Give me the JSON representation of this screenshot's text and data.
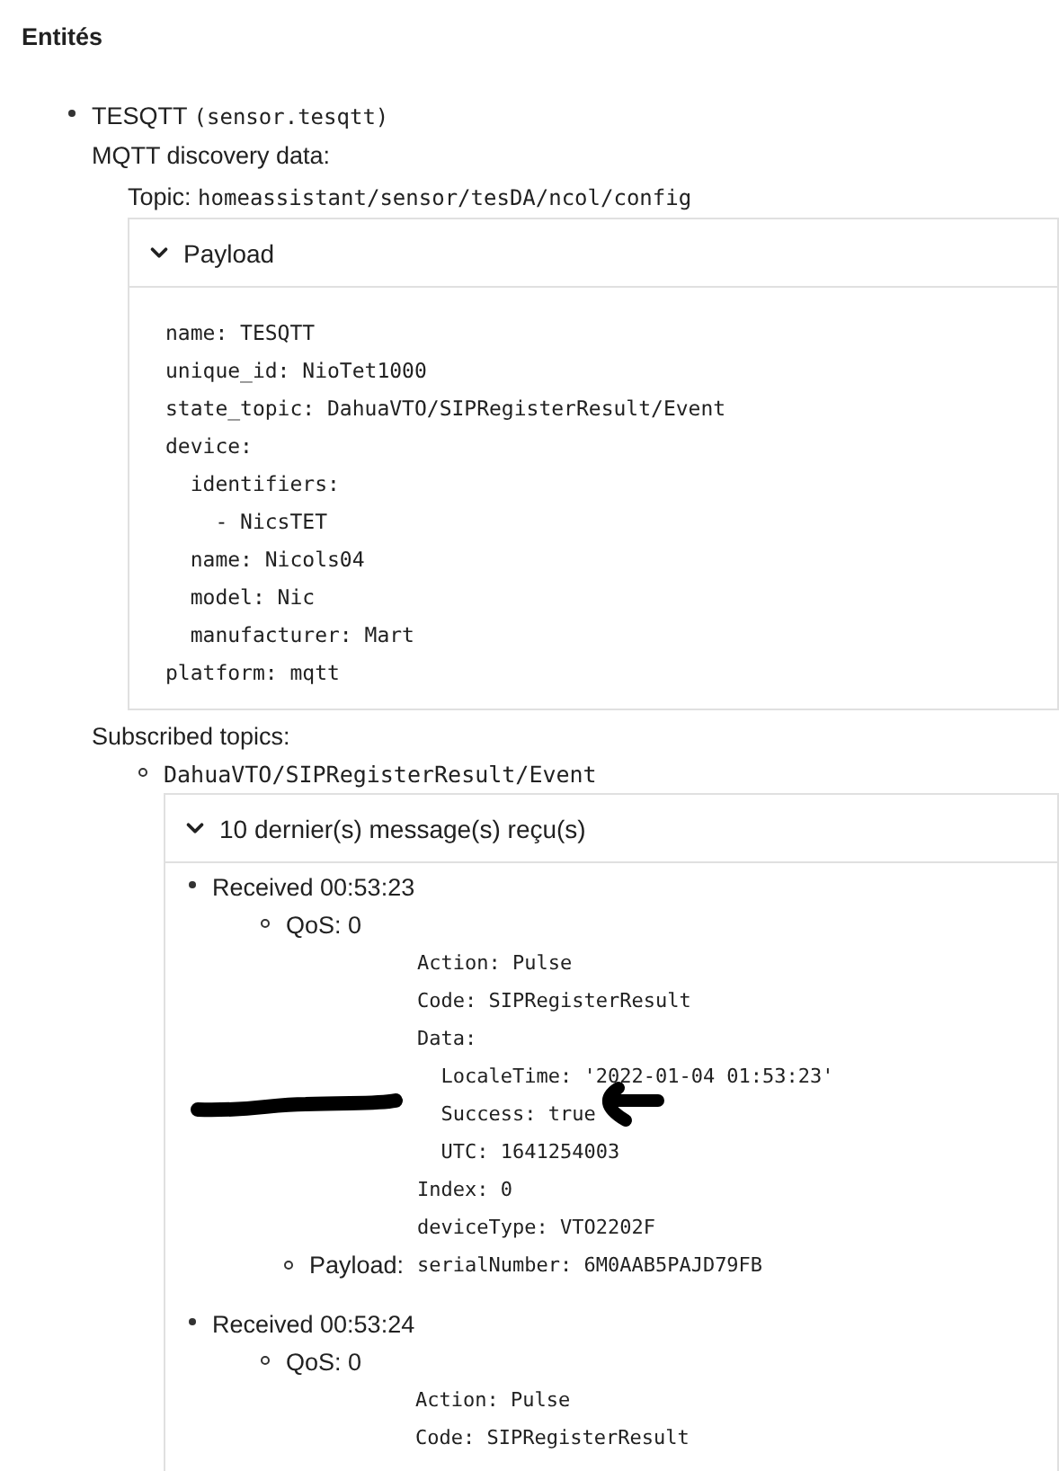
{
  "section_title": "Entités",
  "entities": [
    {
      "name": "TESQTT",
      "entity_id": "(sensor.tesqtt)",
      "discovery_label": "MQTT discovery data:",
      "topic_label": "Topic:",
      "topic": "homeassistant/sensor/tesDA/ncol/config",
      "payload_panel": {
        "title": "Payload",
        "expanded": true,
        "lines": [
          "name: TESQTT",
          "unique_id: NioTet1000",
          "state_topic: DahuaVTO/SIPRegisterResult/Event",
          "device:",
          "  identifiers:",
          "    - NicsTET",
          "  name: Nicols04",
          "  model: Nic",
          "  manufacturer: Mart",
          "platform: mqtt"
        ]
      },
      "subscribed_label": "Subscribed topics:",
      "subscriptions": [
        {
          "topic": "DahuaVTO/SIPRegisterResult/Event",
          "messages_panel": {
            "title": "10 dernier(s) message(s) reçu(s)",
            "expanded": true,
            "messages": [
              {
                "received": "Received 00:53:23",
                "qos": "QoS: 0",
                "payload_label": "Payload:",
                "payload": [
                  "Action: Pulse",
                  "Code: SIPRegisterResult",
                  "Data:",
                  "  LocaleTime: '2022-01-04 01:53:23'",
                  "  Success: true",
                  "  UTC: 1641254003",
                  "Index: 0",
                  "deviceType: VTO2202F",
                  "serialNumber: 6M0AAB5PAJD79FB"
                ]
              },
              {
                "received": "Received 00:53:24",
                "qos": "QoS: 0",
                "payload": [
                  "Action: Pulse",
                  "Code: SIPRegisterResult"
                ]
              }
            ]
          }
        }
      ]
    }
  ],
  "annotations": {
    "strike_line": true,
    "arrow": true
  }
}
